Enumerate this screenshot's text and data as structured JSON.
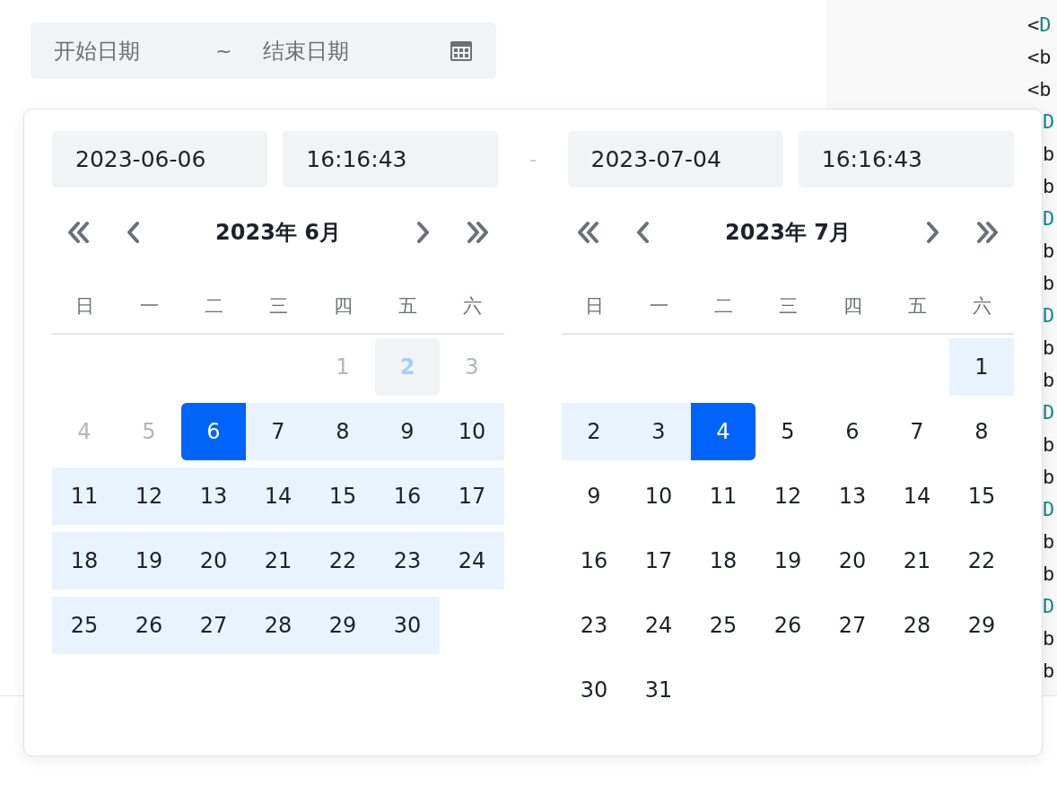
{
  "range_input": {
    "start_placeholder": "开始日期",
    "separator": "~",
    "end_placeholder": "结束日期"
  },
  "code_lines": [
    {
      "kind": "full",
      "parts": [
        {
          "text": "<",
          "kind": "punct"
        },
        {
          "text": "D",
          "kind": "tag"
        }
      ]
    },
    {
      "kind": "full",
      "parts": [
        {
          "text": "<b",
          "kind": "punct"
        }
      ]
    },
    {
      "kind": "full",
      "parts": [
        {
          "text": "<b",
          "kind": "punct"
        }
      ]
    },
    {
      "kind": "clipped",
      "parts": [
        {
          "text": "D",
          "kind": "tag"
        }
      ]
    },
    {
      "kind": "clipped",
      "parts": [
        {
          "text": "b",
          "kind": "punct"
        }
      ]
    },
    {
      "kind": "clipped",
      "parts": [
        {
          "text": "b",
          "kind": "punct"
        }
      ]
    },
    {
      "kind": "clipped",
      "parts": [
        {
          "text": "D",
          "kind": "tag"
        }
      ]
    },
    {
      "kind": "clipped",
      "parts": [
        {
          "text": "b",
          "kind": "punct"
        }
      ]
    },
    {
      "kind": "clipped",
      "parts": [
        {
          "text": "b",
          "kind": "punct"
        }
      ]
    },
    {
      "kind": "clipped",
      "parts": [
        {
          "text": "D",
          "kind": "tag"
        }
      ]
    },
    {
      "kind": "clipped",
      "parts": [
        {
          "text": "b",
          "kind": "punct"
        }
      ]
    },
    {
      "kind": "clipped",
      "parts": [
        {
          "text": "b",
          "kind": "punct"
        }
      ]
    },
    {
      "kind": "clipped",
      "parts": [
        {
          "text": "D",
          "kind": "tag"
        }
      ]
    },
    {
      "kind": "clipped",
      "parts": [
        {
          "text": "b",
          "kind": "punct"
        }
      ]
    },
    {
      "kind": "clipped",
      "parts": [
        {
          "text": "b",
          "kind": "punct"
        }
      ]
    },
    {
      "kind": "clipped",
      "parts": [
        {
          "text": "D",
          "kind": "tag"
        }
      ]
    },
    {
      "kind": "clipped",
      "parts": [
        {
          "text": "b",
          "kind": "punct"
        }
      ]
    },
    {
      "kind": "clipped",
      "parts": [
        {
          "text": "b",
          "kind": "punct"
        }
      ]
    },
    {
      "kind": "clipped",
      "parts": [
        {
          "text": "D",
          "kind": "tag"
        }
      ]
    },
    {
      "kind": "clipped",
      "parts": [
        {
          "text": "b",
          "kind": "punct"
        }
      ]
    },
    {
      "kind": "clipped",
      "parts": [
        {
          "text": "b",
          "kind": "punct"
        }
      ]
    }
  ],
  "popup": {
    "start_date": "2023-06-06",
    "start_time": "16:16:43",
    "separator": "-",
    "end_date": "2023-07-04",
    "end_time": "16:16:43",
    "calendars": [
      {
        "title": "2023年 6月",
        "weekdays": [
          "日",
          "一",
          "二",
          "三",
          "四",
          "五",
          "六"
        ],
        "weeks": [
          [
            {
              "kind": "blank"
            },
            {
              "kind": "blank"
            },
            {
              "kind": "blank"
            },
            {
              "kind": "blank"
            },
            {
              "text": "1",
              "kind": "disabled",
              "selected": false,
              "in_range": false
            },
            {
              "text": "2",
              "kind": "today",
              "selected": false,
              "in_range": false
            },
            {
              "text": "3",
              "kind": "disabled",
              "selected": false,
              "in_range": false
            }
          ],
          [
            {
              "text": "4",
              "kind": "disabled",
              "selected": false,
              "in_range": false
            },
            {
              "text": "5",
              "kind": "disabled",
              "selected": false,
              "in_range": false
            },
            {
              "text": "6",
              "kind": "normal",
              "selected": true,
              "in_range": false
            },
            {
              "text": "7",
              "kind": "normal",
              "selected": false,
              "in_range": true
            },
            {
              "text": "8",
              "kind": "normal",
              "selected": false,
              "in_range": true
            },
            {
              "text": "9",
              "kind": "normal",
              "selected": false,
              "in_range": true
            },
            {
              "text": "10",
              "kind": "normal",
              "selected": false,
              "in_range": true
            }
          ],
          [
            {
              "text": "11",
              "kind": "normal",
              "selected": false,
              "in_range": true
            },
            {
              "text": "12",
              "kind": "normal",
              "selected": false,
              "in_range": true
            },
            {
              "text": "13",
              "kind": "normal",
              "selected": false,
              "in_range": true
            },
            {
              "text": "14",
              "kind": "normal",
              "selected": false,
              "in_range": true
            },
            {
              "text": "15",
              "kind": "normal",
              "selected": false,
              "in_range": true
            },
            {
              "text": "16",
              "kind": "normal",
              "selected": false,
              "in_range": true
            },
            {
              "text": "17",
              "kind": "normal",
              "selected": false,
              "in_range": true
            }
          ],
          [
            {
              "text": "18",
              "kind": "normal",
              "selected": false,
              "in_range": true
            },
            {
              "text": "19",
              "kind": "normal",
              "selected": false,
              "in_range": true
            },
            {
              "text": "20",
              "kind": "normal",
              "selected": false,
              "in_range": true
            },
            {
              "text": "21",
              "kind": "normal",
              "selected": false,
              "in_range": true
            },
            {
              "text": "22",
              "kind": "normal",
              "selected": false,
              "in_range": true
            },
            {
              "text": "23",
              "kind": "normal",
              "selected": false,
              "in_range": true
            },
            {
              "text": "24",
              "kind": "normal",
              "selected": false,
              "in_range": true
            }
          ],
          [
            {
              "text": "25",
              "kind": "normal",
              "selected": false,
              "in_range": true
            },
            {
              "text": "26",
              "kind": "normal",
              "selected": false,
              "in_range": true
            },
            {
              "text": "27",
              "kind": "normal",
              "selected": false,
              "in_range": true
            },
            {
              "text": "28",
              "kind": "normal",
              "selected": false,
              "in_range": true
            },
            {
              "text": "29",
              "kind": "normal",
              "selected": false,
              "in_range": true
            },
            {
              "text": "30",
              "kind": "normal",
              "selected": false,
              "in_range": true
            }
          ]
        ]
      },
      {
        "title": "2023年 7月",
        "weekdays": [
          "日",
          "一",
          "二",
          "三",
          "四",
          "五",
          "六"
        ],
        "weeks": [
          [
            {
              "kind": "blank"
            },
            {
              "kind": "blank"
            },
            {
              "kind": "blank"
            },
            {
              "kind": "blank"
            },
            {
              "kind": "blank"
            },
            {
              "kind": "blank"
            },
            {
              "text": "1",
              "kind": "normal",
              "selected": false,
              "in_range": true
            }
          ],
          [
            {
              "text": "2",
              "kind": "normal",
              "selected": false,
              "in_range": true
            },
            {
              "text": "3",
              "kind": "normal",
              "selected": false,
              "in_range": true
            },
            {
              "text": "4",
              "kind": "normal",
              "selected": true,
              "in_range": false
            },
            {
              "text": "5",
              "kind": "normal",
              "selected": false,
              "in_range": false
            },
            {
              "text": "6",
              "kind": "normal",
              "selected": false,
              "in_range": false
            },
            {
              "text": "7",
              "kind": "normal",
              "selected": false,
              "in_range": false
            },
            {
              "text": "8",
              "kind": "normal",
              "selected": false,
              "in_range": false
            }
          ],
          [
            {
              "text": "9",
              "kind": "normal",
              "selected": false,
              "in_range": false
            },
            {
              "text": "10",
              "kind": "normal",
              "selected": false,
              "in_range": false
            },
            {
              "text": "11",
              "kind": "normal",
              "selected": false,
              "in_range": false
            },
            {
              "text": "12",
              "kind": "normal",
              "selected": false,
              "in_range": false
            },
            {
              "text": "13",
              "kind": "normal",
              "selected": false,
              "in_range": false
            },
            {
              "text": "14",
              "kind": "normal",
              "selected": false,
              "in_range": false
            },
            {
              "text": "15",
              "kind": "normal",
              "selected": false,
              "in_range": false
            }
          ],
          [
            {
              "text": "16",
              "kind": "normal",
              "selected": false,
              "in_range": false
            },
            {
              "text": "17",
              "kind": "normal",
              "selected": false,
              "in_range": false
            },
            {
              "text": "18",
              "kind": "normal",
              "selected": false,
              "in_range": false
            },
            {
              "text": "19",
              "kind": "normal",
              "selected": false,
              "in_range": false
            },
            {
              "text": "20",
              "kind": "normal",
              "selected": false,
              "in_range": false
            },
            {
              "text": "21",
              "kind": "normal",
              "selected": false,
              "in_range": false
            },
            {
              "text": "22",
              "kind": "normal",
              "selected": false,
              "in_range": false
            }
          ],
          [
            {
              "text": "23",
              "kind": "normal",
              "selected": false,
              "in_range": false
            },
            {
              "text": "24",
              "kind": "normal",
              "selected": false,
              "in_range": false
            },
            {
              "text": "25",
              "kind": "normal",
              "selected": false,
              "in_range": false
            },
            {
              "text": "26",
              "kind": "normal",
              "selected": false,
              "in_range": false
            },
            {
              "text": "27",
              "kind": "normal",
              "selected": false,
              "in_range": false
            },
            {
              "text": "28",
              "kind": "normal",
              "selected": false,
              "in_range": false
            },
            {
              "text": "29",
              "kind": "normal",
              "selected": false,
              "in_range": false
            }
          ],
          [
            {
              "text": "30",
              "kind": "normal",
              "selected": false,
              "in_range": false
            },
            {
              "text": "31",
              "kind": "normal",
              "selected": false,
              "in_range": false
            }
          ]
        ]
      }
    ]
  }
}
